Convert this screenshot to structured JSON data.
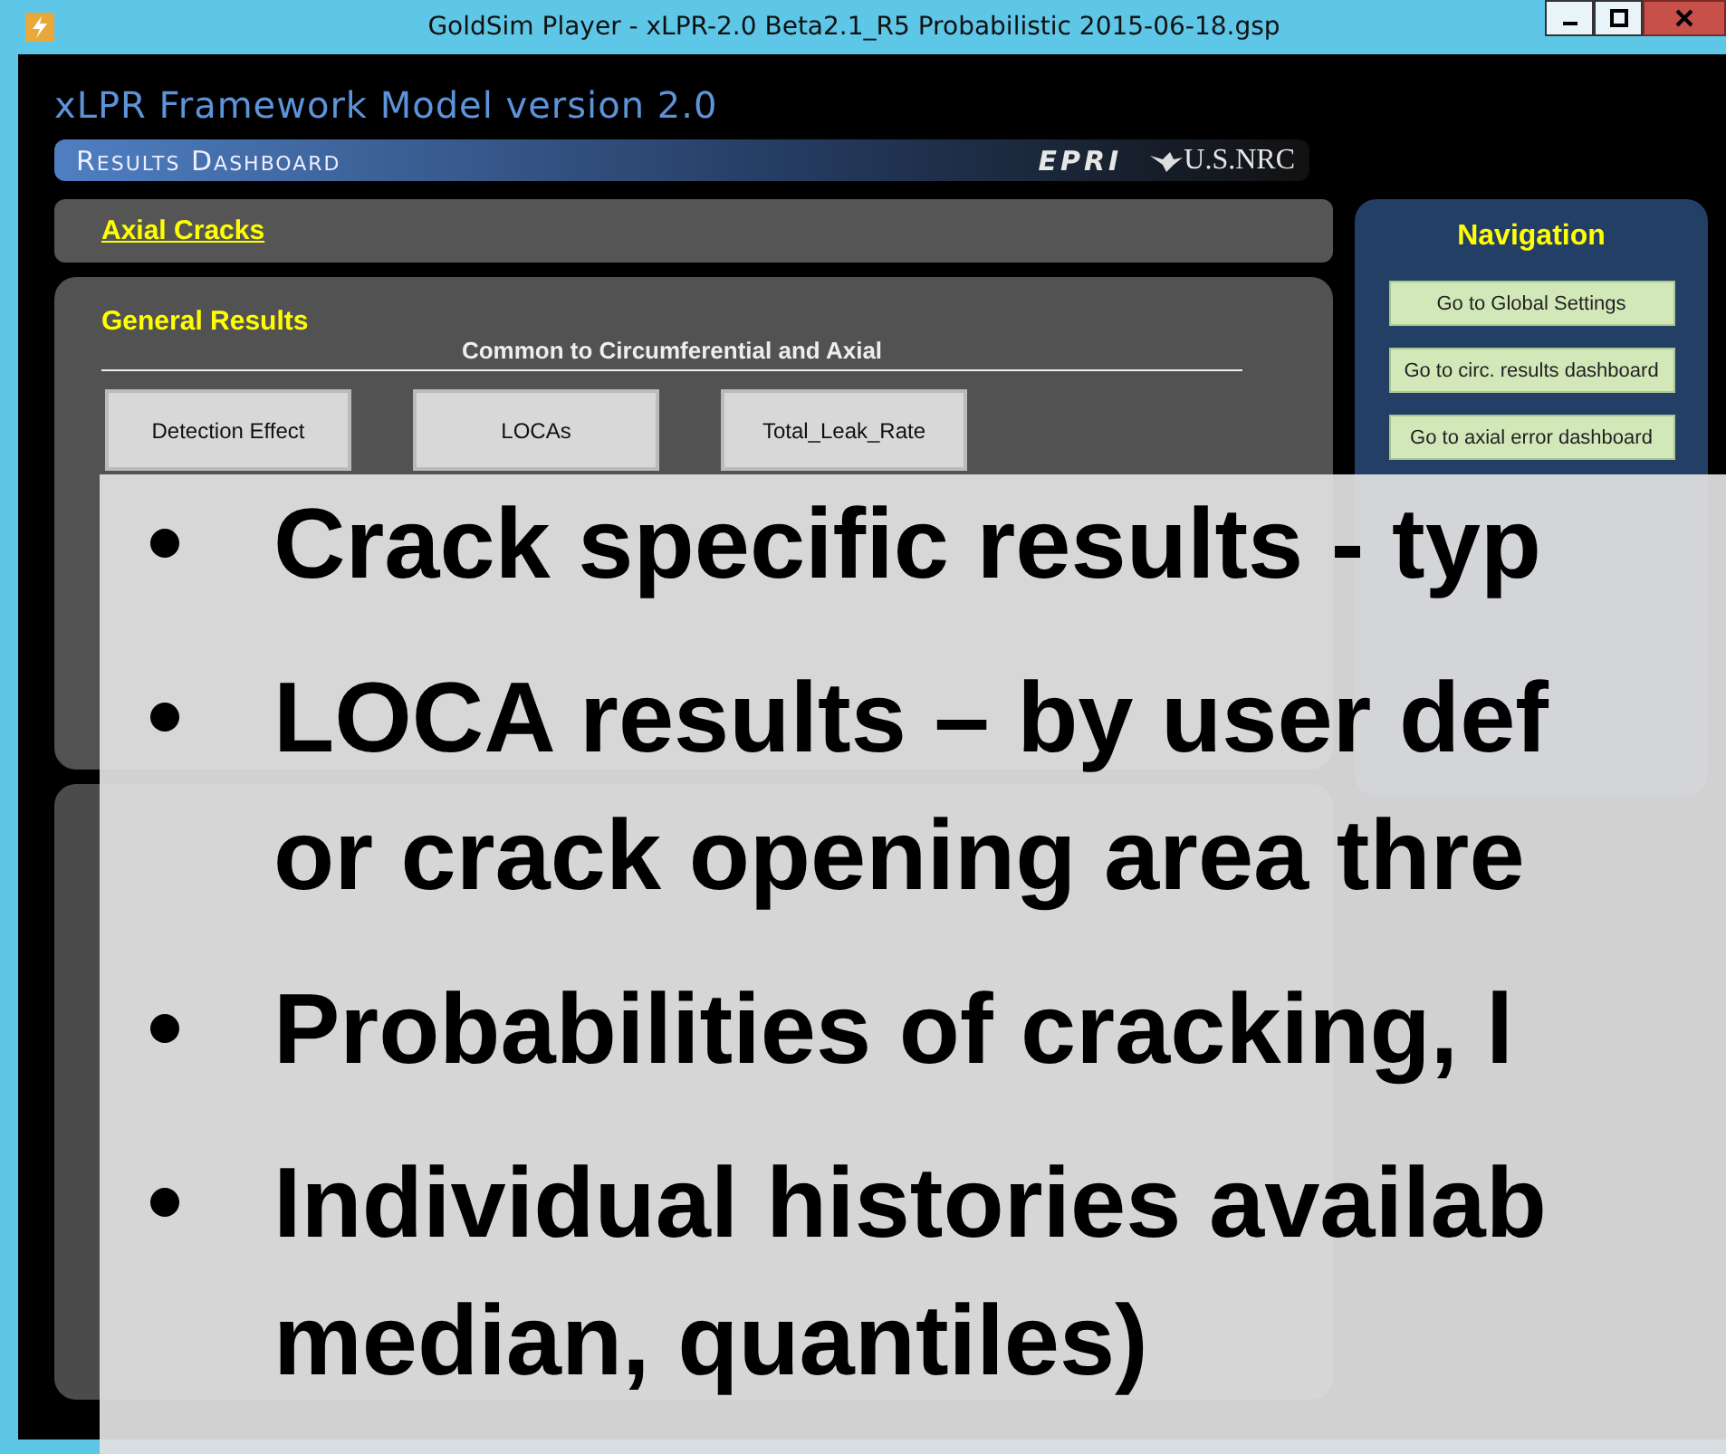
{
  "window": {
    "title": "GoldSim Player - xLPR-2.0 Beta2.1_R5 Probabilistic 2015-06-18.gsp"
  },
  "header": {
    "title": "xLPR Framework Model version 2.0",
    "banner": "Results Dashboard",
    "logos": [
      "EPRI",
      "U.S.NRC"
    ]
  },
  "section": {
    "link": "Axial Cracks"
  },
  "general_results": {
    "title": "General Results",
    "subtitle": "Common to Circumferential and Axial",
    "buttons": [
      "Detection Effect",
      "LOCAs",
      "Total_Leak_Rate"
    ]
  },
  "navigation": {
    "title": "Navigation",
    "buttons": [
      "Go to Global Settings",
      "Go to circ. results dashboard",
      "Go to axial error dashboard"
    ]
  },
  "overlay": {
    "bullets": [
      {
        "lines": [
          "Crack specific results  - typ"
        ]
      },
      {
        "lines": [
          "LOCA results – by user def",
          "or crack opening area thre"
        ]
      },
      {
        "lines": [
          "Probabilities of cracking, l"
        ]
      },
      {
        "lines": [
          "Individual histories availab",
          "median, quantiles)"
        ]
      }
    ]
  }
}
